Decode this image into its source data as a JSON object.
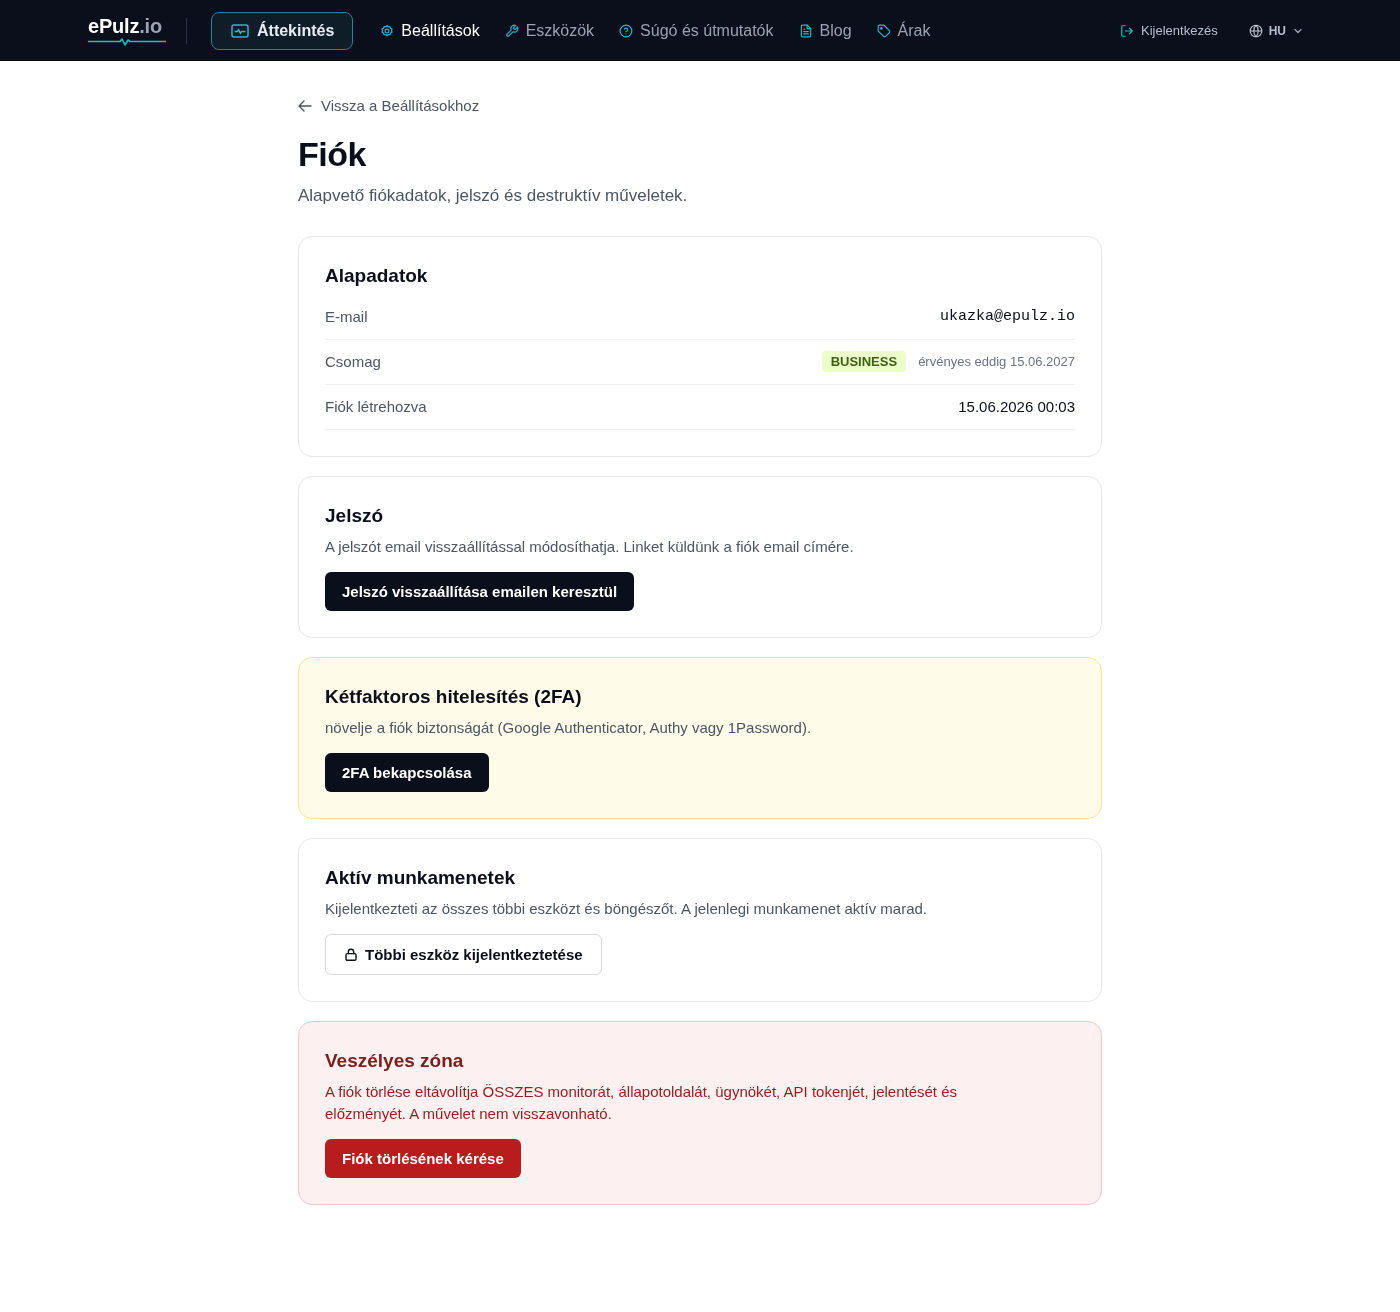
{
  "nav": {
    "logo": {
      "name": "ePulz",
      "suffix": ".io"
    },
    "overview_button": {
      "label": "Áttekintés"
    },
    "items": [
      {
        "label": "Beállítások",
        "selected": true
      },
      {
        "label": "Eszközök",
        "selected": false
      },
      {
        "label": "Súgó és útmutatók",
        "selected": false
      },
      {
        "label": "Blog",
        "selected": false
      },
      {
        "label": "Árak",
        "selected": false
      }
    ],
    "logout": {
      "label": "Kijelentkezés"
    },
    "language": {
      "label": "HU"
    }
  },
  "back_link": {
    "label": "Vissza a Beállításokhoz"
  },
  "page": {
    "title": "Fiók",
    "subtitle": "Alapvető fiókadatok, jelszó és destruktív műveletek."
  },
  "sections": [
    {
      "kind": "details",
      "title": "Alapadatok",
      "rows": [
        {
          "kind": "mono",
          "label": "E-mail",
          "value": "ukazka@epulz.io"
        },
        {
          "kind": "plan",
          "label": "Csomag",
          "badge": "BUSINESS",
          "value": "érvényes eddig 15.06.2027"
        },
        {
          "kind": "text",
          "label": "Fiók létrehozva",
          "value": "15.06.2026 00:03"
        }
      ]
    },
    {
      "kind": "plain",
      "title": "Jelszó",
      "description": "A jelszót email visszaállítással módosíthatja. Linket küldünk a fiók email címére.",
      "button": {
        "kind": "dark",
        "label": "Jelszó visszaállítása emailen keresztül"
      }
    },
    {
      "kind": "warning",
      "title": "Kétfaktoros hitelesítés (2FA)",
      "description": "növelje a fiók biztonságát (Google Authenticator, Authy vagy 1Password).",
      "button": {
        "kind": "dark",
        "label": "2FA bekapcsolása"
      }
    },
    {
      "kind": "plain",
      "title": "Aktív munkamenetek",
      "description": "Kijelentkezteti az összes többi eszközt és böngészőt. A jelenlegi munkamenet aktív marad.",
      "button": {
        "kind": "outline",
        "label": "Többi eszköz kijelentkeztetése"
      }
    },
    {
      "kind": "danger",
      "title": "Veszélyes zóna",
      "description": "A fiók törlése eltávolítja ÖSSZES monitorát, állapotoldalát, ügynökét, API tokenjét, jelentését és előzményét. A művelet nem visszavonható.",
      "button": {
        "kind": "danger",
        "label": "Fiók törlésének kérése"
      }
    }
  ]
}
